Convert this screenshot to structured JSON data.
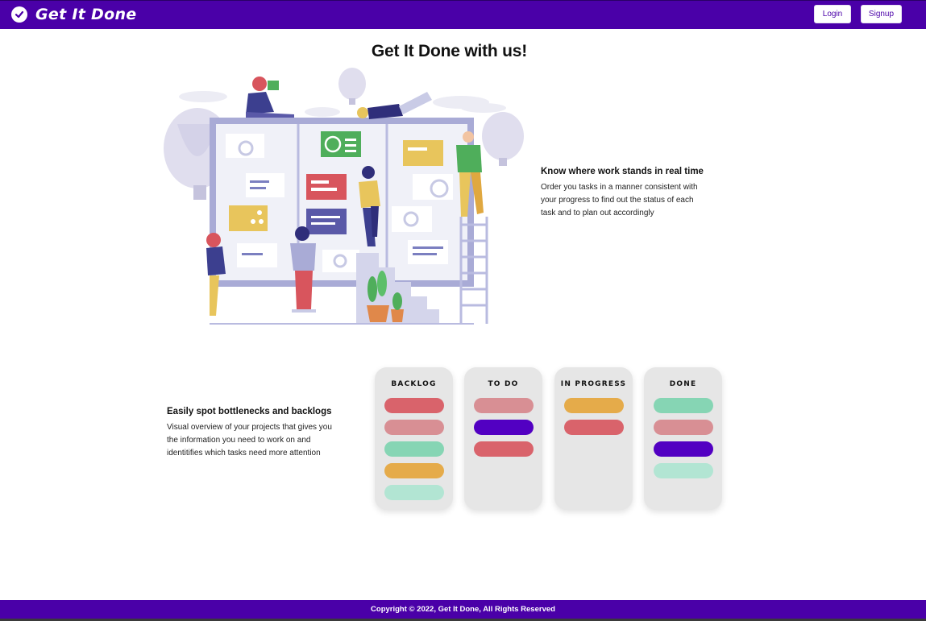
{
  "navbar": {
    "brand_icon": "check-circle-icon",
    "brand": "Get It Done",
    "login_label": "Login",
    "signup_label": "Signup",
    "bg_color": "#4a00a8"
  },
  "hero": {
    "title": "Get It Done with us!"
  },
  "features": [
    {
      "title": "Know where work stands in real time",
      "text": "Order you tasks in a manner consistent with your progress to find out the status of each task and to plan out accordingly"
    },
    {
      "title": "Easily spot bottlenecks and backlogs",
      "text": "Visual overview of your projects that gives you the information you need to work on and identitifies which tasks need more attention"
    }
  ],
  "kanban": {
    "columns": [
      {
        "title": "BACKLOG",
        "cards": [
          "#d9636b",
          "#d88f94",
          "#86d5b4",
          "#e5ab4a",
          "#b2e5d3"
        ]
      },
      {
        "title": "TO DO",
        "cards": [
          "#d88f94",
          "#5200c2",
          "#d9636b"
        ]
      },
      {
        "title": "IN PROGRESS",
        "cards": [
          "#e5ab4a",
          "#d9636b"
        ]
      },
      {
        "title": "DONE",
        "cards": [
          "#86d5b4",
          "#d88f94",
          "#5200c2",
          "#b2e5d3"
        ]
      }
    ]
  },
  "footer": {
    "text": "Copyright © 2022, Get It Done, All Rights Reserved"
  }
}
